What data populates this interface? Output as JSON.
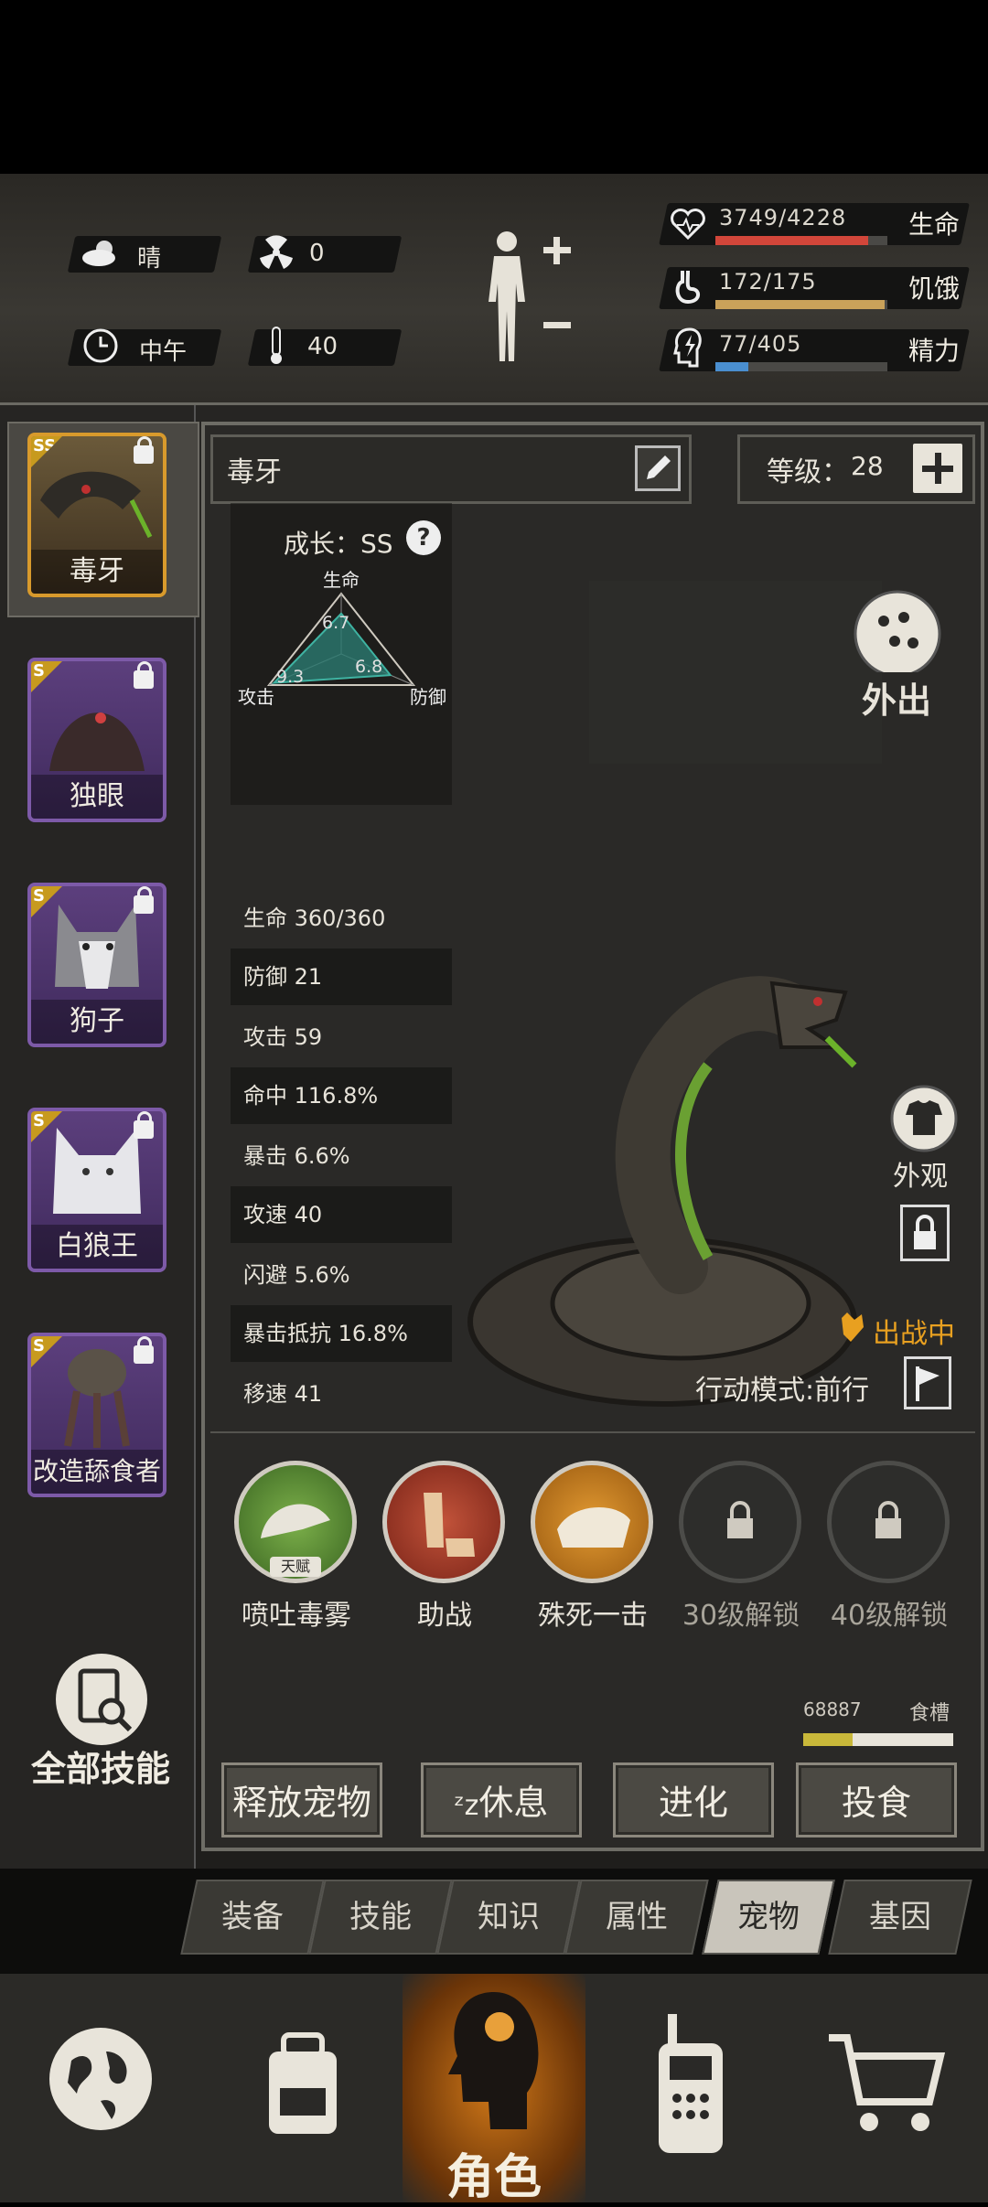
{
  "status": {
    "weather": "晴",
    "radiation": "0",
    "time_of_day": "中午",
    "temperature": "40",
    "health": {
      "label": "生命",
      "value": "3749/4228",
      "fraction": 0.887,
      "color": "#d2463a"
    },
    "hunger": {
      "label": "饥饿",
      "value": "172/175",
      "fraction": 0.983,
      "color": "#caa25a"
    },
    "energy": {
      "label": "精力",
      "value": "77/405",
      "fraction": 0.19,
      "color": "#4a8fd0"
    }
  },
  "pets": [
    {
      "name": "毒牙",
      "rank": "SS",
      "selected": true
    },
    {
      "name": "独眼",
      "rank": "S"
    },
    {
      "name": "狗子",
      "rank": "S"
    },
    {
      "name": "白狼王",
      "rank": "S"
    },
    {
      "name": "改造舔食者",
      "rank": "S"
    }
  ],
  "all_skills_label": "全部技能",
  "pet": {
    "name": "毒牙",
    "level_label": "等级：",
    "level": "28",
    "growth_label": "成长：SS",
    "radar": {
      "life_label": "生命",
      "defense_label": "防御",
      "attack_label": "攻击",
      "life": "6.7",
      "defense": "6.8",
      "attack": "9.3"
    },
    "stats": [
      {
        "label": "生命",
        "value": "360/360"
      },
      {
        "label": "防御",
        "value": "21"
      },
      {
        "label": "攻击",
        "value": "59"
      },
      {
        "label": "命中",
        "value": "116.8%"
      },
      {
        "label": "暴击",
        "value": "6.6%"
      },
      {
        "label": "攻速",
        "value": "40"
      },
      {
        "label": "闪避",
        "value": "5.6%"
      },
      {
        "label": "暴击抵抗",
        "value": "16.8%"
      },
      {
        "label": "移速",
        "value": "41"
      }
    ],
    "outing_label": "外出",
    "appearance_label": "外观",
    "battle_status": "出战中",
    "action_mode": "行动模式:前行"
  },
  "skills": [
    {
      "label": "喷吐毒雾",
      "tag": "天赋"
    },
    {
      "label": "助战"
    },
    {
      "label": "殊死一击"
    },
    {
      "label": "30级解锁"
    },
    {
      "label": "40级解锁"
    }
  ],
  "food": {
    "value": "68887",
    "label": "食槽",
    "fraction": 0.33
  },
  "buttons": {
    "release": "释放宠物",
    "rest": "休息",
    "evolve": "进化",
    "feed": "投食"
  },
  "tabs": [
    "装备",
    "技能",
    "知识",
    "属性",
    "宠物",
    "基因"
  ],
  "active_tab": "宠物",
  "nav": {
    "character": "角色"
  }
}
